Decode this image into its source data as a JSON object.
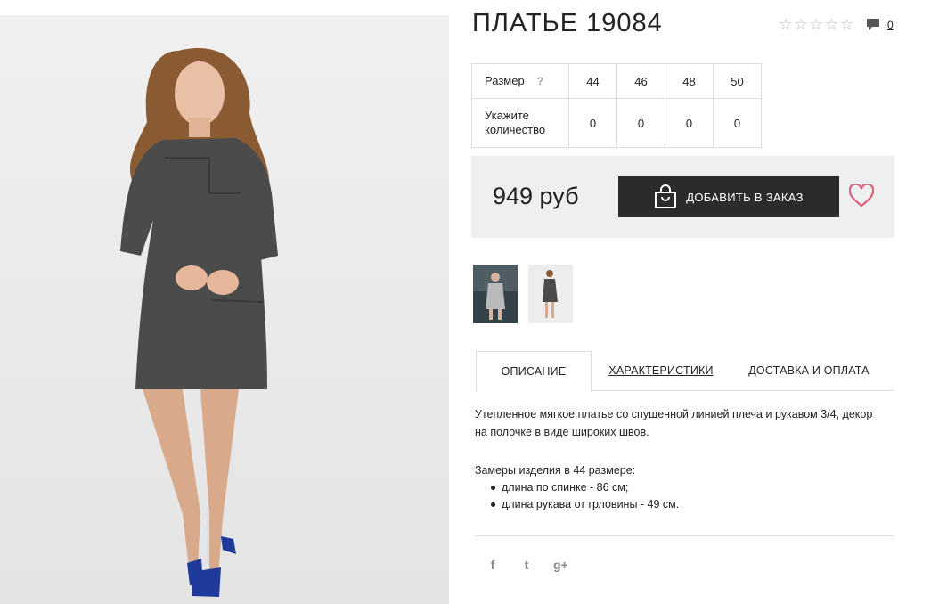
{
  "product": {
    "title": "ПЛАТЬЕ 19084",
    "rating_stars": [
      "☆",
      "☆",
      "☆",
      "☆",
      "☆"
    ],
    "comment_count": "0"
  },
  "sizes": {
    "size_label": "Размер",
    "help_label": "?",
    "qty_label": "Укажите количество",
    "columns": [
      "44",
      "46",
      "48",
      "50"
    ],
    "quantities": [
      "0",
      "0",
      "0",
      "0"
    ]
  },
  "buy": {
    "price": "949 руб",
    "add_label": "ДОБАВИТЬ В ЗАКАЗ"
  },
  "tabs": [
    "ОПИСАНИЕ",
    "ХАРАКТЕРИСТИКИ",
    "ДОСТАВКА И ОПЛАТА"
  ],
  "description": {
    "text": "Утепленное мягкое платье со спущенной линией плеча и рукавом 3/4, декор на полочке в виде широких швов.",
    "measures_title": "Замеры изделия в 44 размере:",
    "measures": [
      "длина по спинке - 86 см;",
      "длина рукава от грловины - 49 см."
    ]
  },
  "social": {
    "facebook": "f",
    "twitter": "t",
    "googleplus": "g+"
  },
  "colors": {
    "dress": "#4b4b4b",
    "button": "#2b2b2b",
    "heart": "#d9607a",
    "shoe": "#1f3a9a"
  }
}
